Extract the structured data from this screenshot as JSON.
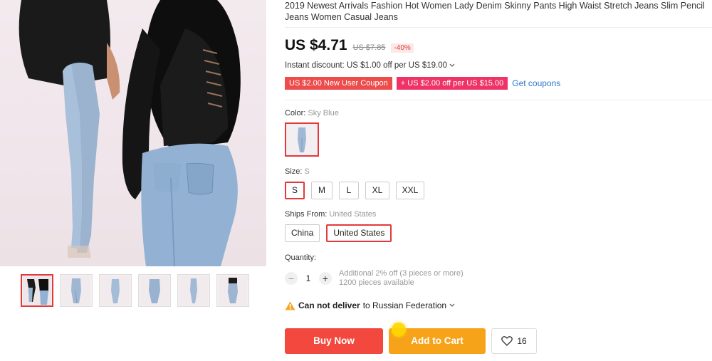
{
  "product": {
    "title": "2019 Newest Arrivals Fashion Hot Women Lady Denim Skinny Pants High Waist Stretch Jeans Slim Pencil Jeans Women Casual Jeans",
    "price": "US $4.71",
    "original_price": "US $7.85",
    "discount_pct": "-40%",
    "instant_discount": "Instant discount: US $1.00 off per US $19.00"
  },
  "coupons": {
    "new_user": "US $2.00 New User Coupon",
    "store": "+ US $2.00 off per US $15.00",
    "get_coupons": "Get coupons"
  },
  "color": {
    "label": "Color:",
    "value": "Sky Blue"
  },
  "size": {
    "label": "Size:",
    "value": "S",
    "options": [
      "S",
      "M",
      "L",
      "XL",
      "XXL"
    ],
    "selected": "S"
  },
  "ships_from": {
    "label": "Ships From:",
    "value": "United States",
    "options": [
      "China",
      "United States"
    ],
    "selected": "United States"
  },
  "quantity": {
    "label": "Quantity:",
    "value": "1",
    "minus": "−",
    "plus": "+",
    "note_line1": "Additional 2% off (3 pieces or more)",
    "note_line2": "1200 pieces available"
  },
  "delivery": {
    "warning": "Can not deliver",
    "rest": "to Russian Federation"
  },
  "actions": {
    "buy_now": "Buy Now",
    "add_to_cart": "Add to Cart",
    "wishlist_count": "16"
  },
  "icons": {
    "chevron": "chevron-down-icon",
    "warning": "warning-icon",
    "heart": "heart-icon"
  },
  "colors": {
    "accent_red": "#e4393c",
    "buy_button": "#f2483d",
    "cart_button": "#f6a31a",
    "coupon_red": "#ec4c4c",
    "coupon_pink": "#ef3366",
    "link_blue": "#2b77c6"
  }
}
